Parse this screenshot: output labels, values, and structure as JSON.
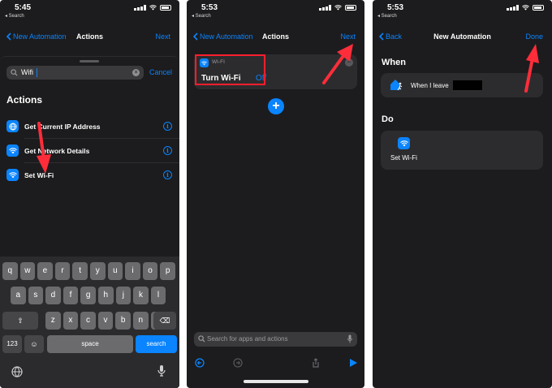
{
  "colors": {
    "accent": "#0a84ff",
    "background": "#1c1c1e",
    "card": "#2c2c2e",
    "highlight_red": "#ff1e2d"
  },
  "panel1": {
    "status": {
      "time": "5:45",
      "back_app": "◂ Search"
    },
    "nav": {
      "back_label": "New Automation",
      "title": "Actions",
      "right": "Next"
    },
    "search": {
      "value": "Wifi",
      "cancel": "Cancel"
    },
    "section_title": "Actions",
    "actions": [
      {
        "label": "Get Current IP Address",
        "icon": "globe-icon"
      },
      {
        "label": "Get Network Details",
        "icon": "wifi-icon"
      },
      {
        "label": "Set Wi-Fi",
        "icon": "wifi-icon"
      }
    ],
    "keyboard": {
      "row1": [
        "q",
        "w",
        "e",
        "r",
        "t",
        "y",
        "u",
        "i",
        "o",
        "p"
      ],
      "row2": [
        "a",
        "s",
        "d",
        "f",
        "g",
        "h",
        "j",
        "k",
        "l"
      ],
      "row3": [
        "z",
        "x",
        "c",
        "v",
        "b",
        "n",
        "m"
      ],
      "numbers": "123",
      "space": "space",
      "search": "search"
    }
  },
  "panel2": {
    "status": {
      "time": "5:53",
      "back_app": "◂ Search"
    },
    "nav": {
      "back_label": "New Automation",
      "title": "Actions",
      "right": "Next"
    },
    "card": {
      "category": "WI-FI",
      "action": "Turn Wi-Fi",
      "value": "Off"
    },
    "search_placeholder": "Search for apps and actions"
  },
  "panel3": {
    "status": {
      "time": "5:53",
      "back_app": "◂ Search"
    },
    "nav": {
      "back_label": "Back",
      "title": "New Automation",
      "right": "Done"
    },
    "when_title": "When",
    "when_text": "When I leave",
    "do_title": "Do",
    "do_action": "Set Wi-Fi"
  }
}
